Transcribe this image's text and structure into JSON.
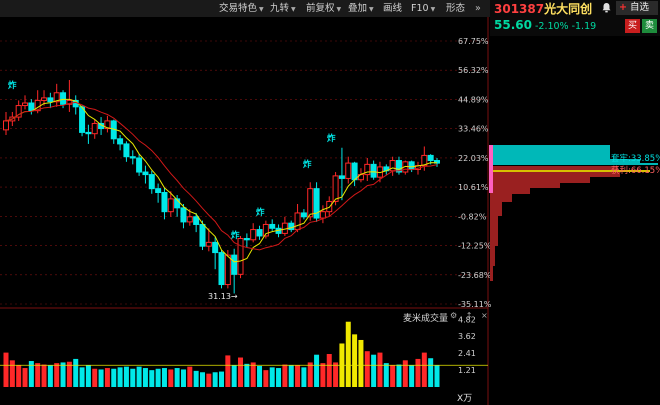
{
  "toolbar": {
    "items": [
      {
        "label": "交易特色",
        "caret": true
      },
      {
        "label": "九转",
        "caret": true
      },
      {
        "label": "前复权",
        "caret": true
      },
      {
        "label": "叠加",
        "caret": true
      },
      {
        "label": "画线",
        "caret": false
      },
      {
        "label": "F10",
        "caret": true
      },
      {
        "label": "形态",
        "caret": false
      }
    ]
  },
  "stock": {
    "code": "301387",
    "name": "光大同创",
    "price": "55.60",
    "change_pct": "-2.10%",
    "change_amt": "-1.19",
    "watch_label": "自选",
    "buy_label": "买",
    "sell_label": "卖"
  },
  "colors": {
    "up": "#ff2828",
    "down": "#00e8e8",
    "ma_fast": "#e8e800",
    "ma_slow": "#d01818",
    "grid": "#7a1010"
  },
  "price_axis": {
    "ticks": [
      "67.75%",
      "56.32%",
      "44.89%",
      "33.46%",
      "22.03%",
      "10.61%",
      "-0.82%",
      "-12.25%",
      "-23.68%",
      "-35.11%"
    ]
  },
  "volume_axis": {
    "ticks": [
      "4.82",
      "3.62",
      "2.41",
      "1.21"
    ],
    "unit": "X万",
    "title": "麦米成交量"
  },
  "annotations": {
    "low_label": "31.13",
    "zha_label": "炸",
    "chips_cost_label": "套牢:33.85%",
    "chips_profit_label": "获利:66.15%"
  },
  "chart_data": {
    "type": "candlestick",
    "title": "",
    "ylim_pct": [
      -35.11,
      67.75
    ],
    "candles": [
      [
        33.0,
        36.5,
        31.0,
        40.0
      ],
      [
        36.5,
        38.0,
        34.5,
        40.0
      ],
      [
        38.0,
        42.5,
        36.5,
        44.5
      ],
      [
        42.5,
        43.5,
        41.0,
        46.5
      ],
      [
        43.5,
        40.5,
        39.0,
        45.0
      ],
      [
        40.5,
        44.5,
        39.5,
        48.5
      ],
      [
        44.5,
        45.5,
        42.5,
        48.5
      ],
      [
        45.5,
        44.0,
        41.5,
        47.5
      ],
      [
        44.0,
        47.5,
        42.0,
        51.0
      ],
      [
        47.5,
        43.0,
        41.5,
        48.5
      ],
      [
        43.0,
        44.5,
        40.0,
        52.5
      ],
      [
        44.5,
        42.0,
        39.0,
        46.5
      ],
      [
        42.0,
        32.0,
        30.5,
        42.5
      ],
      [
        32.0,
        31.5,
        27.5,
        35.0
      ],
      [
        31.5,
        35.5,
        29.5,
        37.0
      ],
      [
        35.5,
        33.5,
        31.0,
        38.0
      ],
      [
        33.5,
        36.5,
        32.0,
        38.5
      ],
      [
        36.5,
        29.5,
        27.5,
        37.0
      ],
      [
        29.5,
        27.5,
        25.0,
        31.0
      ],
      [
        27.5,
        22.5,
        20.5,
        28.5
      ],
      [
        22.5,
        22.0,
        19.5,
        25.0
      ],
      [
        22.0,
        16.5,
        15.0,
        23.5
      ],
      [
        16.5,
        15.5,
        12.0,
        19.0
      ],
      [
        15.5,
        10.0,
        8.0,
        17.0
      ],
      [
        10.0,
        8.5,
        4.5,
        12.0
      ],
      [
        8.5,
        1.0,
        -2.0,
        10.5
      ],
      [
        1.0,
        6.0,
        -1.0,
        9.0
      ],
      [
        6.0,
        2.5,
        -1.0,
        7.5
      ],
      [
        2.5,
        -3.0,
        -5.5,
        4.0
      ],
      [
        -3.0,
        -1.0,
        -4.5,
        2.0
      ],
      [
        -1.0,
        -4.0,
        -7.0,
        0.5
      ],
      [
        -4.0,
        -12.5,
        -14.0,
        -2.5
      ],
      [
        -12.5,
        -11.0,
        -14.5,
        -5.5
      ],
      [
        -11.0,
        -15.0,
        -21.5,
        -9.0
      ],
      [
        -15.0,
        -27.5,
        -29.0,
        -14.0
      ],
      [
        -27.5,
        -16.0,
        -29.0,
        -14.0
      ],
      [
        -16.0,
        -23.5,
        -31.0,
        -13.5
      ],
      [
        -23.5,
        -9.5,
        -25.0,
        -8.5
      ],
      [
        -9.5,
        -10.0,
        -13.0,
        -7.5
      ],
      [
        -10.0,
        -6.0,
        -11.0,
        -3.5
      ],
      [
        -6.0,
        -8.5,
        -10.0,
        -4.5
      ],
      [
        -8.5,
        -4.0,
        -9.5,
        -2.5
      ],
      [
        -4.0,
        -5.5,
        -6.5,
        -2.0
      ],
      [
        -5.5,
        -7.5,
        -9.0,
        -4.0
      ],
      [
        -7.5,
        -3.5,
        -8.5,
        -1.0
      ],
      [
        -3.5,
        -6.0,
        -7.0,
        -2.5
      ],
      [
        -6.0,
        0.5,
        -7.0,
        4.0
      ],
      [
        0.5,
        -1.0,
        -2.0,
        2.0
      ],
      [
        -1.0,
        10.0,
        -2.5,
        12.5
      ],
      [
        10.0,
        -1.5,
        -3.0,
        12.5
      ],
      [
        -1.5,
        1.0,
        -3.5,
        3.5
      ],
      [
        1.0,
        5.0,
        -1.0,
        7.0
      ],
      [
        5.0,
        15.0,
        3.5,
        16.5
      ],
      [
        15.0,
        14.0,
        5.5,
        26.0
      ],
      [
        14.0,
        20.0,
        12.0,
        22.5
      ],
      [
        20.0,
        13.5,
        11.0,
        20.5
      ],
      [
        13.5,
        15.5,
        12.5,
        18.0
      ],
      [
        15.5,
        19.5,
        13.0,
        22.0
      ],
      [
        19.5,
        14.5,
        13.5,
        21.0
      ],
      [
        14.5,
        18.5,
        12.5,
        20.5
      ],
      [
        18.5,
        17.0,
        15.5,
        19.5
      ],
      [
        17.0,
        21.0,
        15.0,
        22.5
      ],
      [
        21.0,
        16.5,
        15.5,
        22.5
      ],
      [
        16.5,
        20.5,
        15.5,
        21.0
      ],
      [
        20.5,
        17.5,
        16.5,
        21.0
      ],
      [
        17.5,
        19.0,
        15.5,
        20.5
      ],
      [
        19.0,
        23.0,
        17.0,
        26.5
      ],
      [
        23.0,
        21.0,
        19.5,
        23.5
      ],
      [
        21.0,
        20.0,
        18.5,
        22.0
      ]
    ],
    "volumes": [
      2.45,
      1.9,
      1.55,
      1.35,
      1.85,
      1.7,
      1.6,
      1.55,
      1.7,
      1.75,
      1.8,
      2.0,
      1.4,
      1.55,
      1.3,
      1.25,
      1.35,
      1.3,
      1.4,
      1.45,
      1.3,
      1.45,
      1.35,
      1.2,
      1.3,
      1.35,
      1.25,
      1.35,
      1.25,
      1.45,
      1.15,
      1.05,
      0.95,
      1.05,
      1.1,
      2.25,
      1.55,
      2.1,
      1.65,
      1.75,
      1.5,
      1.2,
      1.4,
      1.35,
      1.6,
      1.55,
      1.55,
      1.4,
      1.75,
      2.3,
      1.7,
      2.35,
      1.75,
      3.1,
      4.65,
      3.75,
      3.35,
      2.55,
      2.3,
      2.45,
      1.7,
      1.55,
      1.6,
      1.9,
      1.55,
      2.0,
      2.45,
      2.05,
      1.55
    ],
    "chips_profit_pct": "66.15%",
    "chips_cost_pct": "33.85%"
  }
}
